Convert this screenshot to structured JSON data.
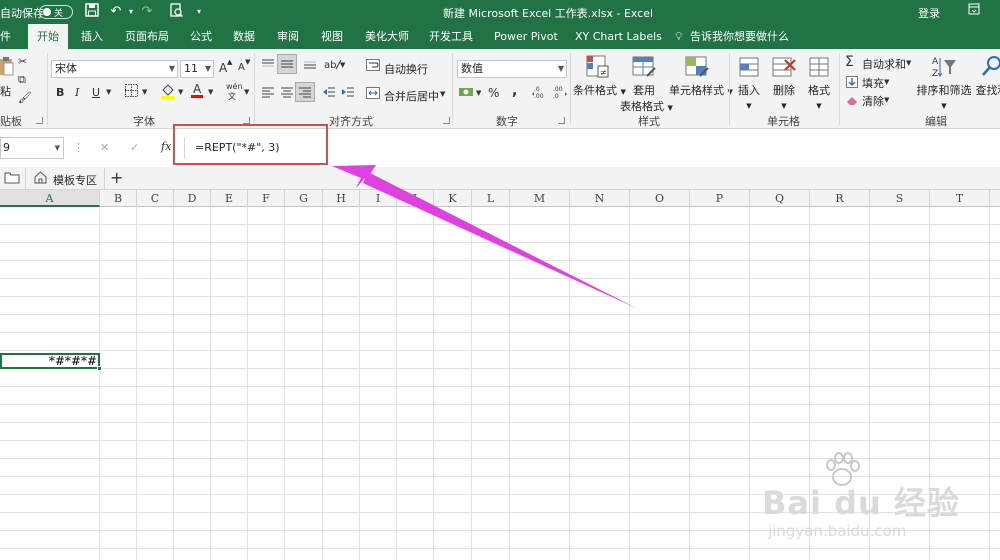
{
  "title_bar": {
    "autosave_label": "自动保存",
    "autosave_state": "关",
    "document_title": "新建 Microsoft Excel 工作表.xlsx  -  Excel",
    "login": "登录"
  },
  "ribbon_tabs": [
    "件",
    "开始",
    "插入",
    "页面布局",
    "公式",
    "数据",
    "审阅",
    "视图",
    "美化大师",
    "开发工具",
    "Power Pivot",
    "XY Chart Labels"
  ],
  "active_tab": "开始",
  "tell_me": "告诉我你想要做什么",
  "ribbon": {
    "clipboard": {
      "paste": "粘",
      "group": "贴板"
    },
    "font": {
      "name": "宋体",
      "size": "11",
      "grow": "A",
      "shrink": "A",
      "bold": "B",
      "italic": "I",
      "underline": "U",
      "wen": "wén",
      "group": "字体"
    },
    "alignment": {
      "wrap": "自动换行",
      "merge": "合并后居中",
      "group": "对齐方式"
    },
    "number": {
      "format": "数值",
      "percent": "%",
      "comma": ",",
      "group": "数字"
    },
    "styles": {
      "conditional": "条件格式",
      "table_line1": "套用",
      "table_line2": "表格格式",
      "cell_styles": "单元格样式",
      "group": "样式"
    },
    "cells": {
      "insert": "插入",
      "delete": "删除",
      "format": "格式",
      "group": "单元格"
    },
    "editing": {
      "autosum": "自动求和",
      "fill": "填充",
      "clear": "清除",
      "sort": "排序和筛选",
      "find": "查找和",
      "group": "编辑"
    }
  },
  "formula_bar": {
    "name_box": "9",
    "cancel": "✕",
    "enter": "✓",
    "fx": "fx",
    "formula": "=REPT(\"*#\", 3)"
  },
  "sheet_tabs": {
    "template_tab": "模板专区",
    "add": "+"
  },
  "columns": [
    "A",
    "B",
    "C",
    "D",
    "E",
    "F",
    "G",
    "H",
    "I",
    "J",
    "K",
    "L",
    "M",
    "N",
    "O",
    "P",
    "Q",
    "R",
    "S",
    "T"
  ],
  "selected_column": "A",
  "active_cell_value": "*#*#*#",
  "watermark": {
    "brand": "Bai  du 经验",
    "url": "jingyan.baidu.com"
  },
  "colors": {
    "excel_green": "#217346",
    "annotation_red": "#d0504c",
    "arrow_magenta": "#e040e0"
  }
}
